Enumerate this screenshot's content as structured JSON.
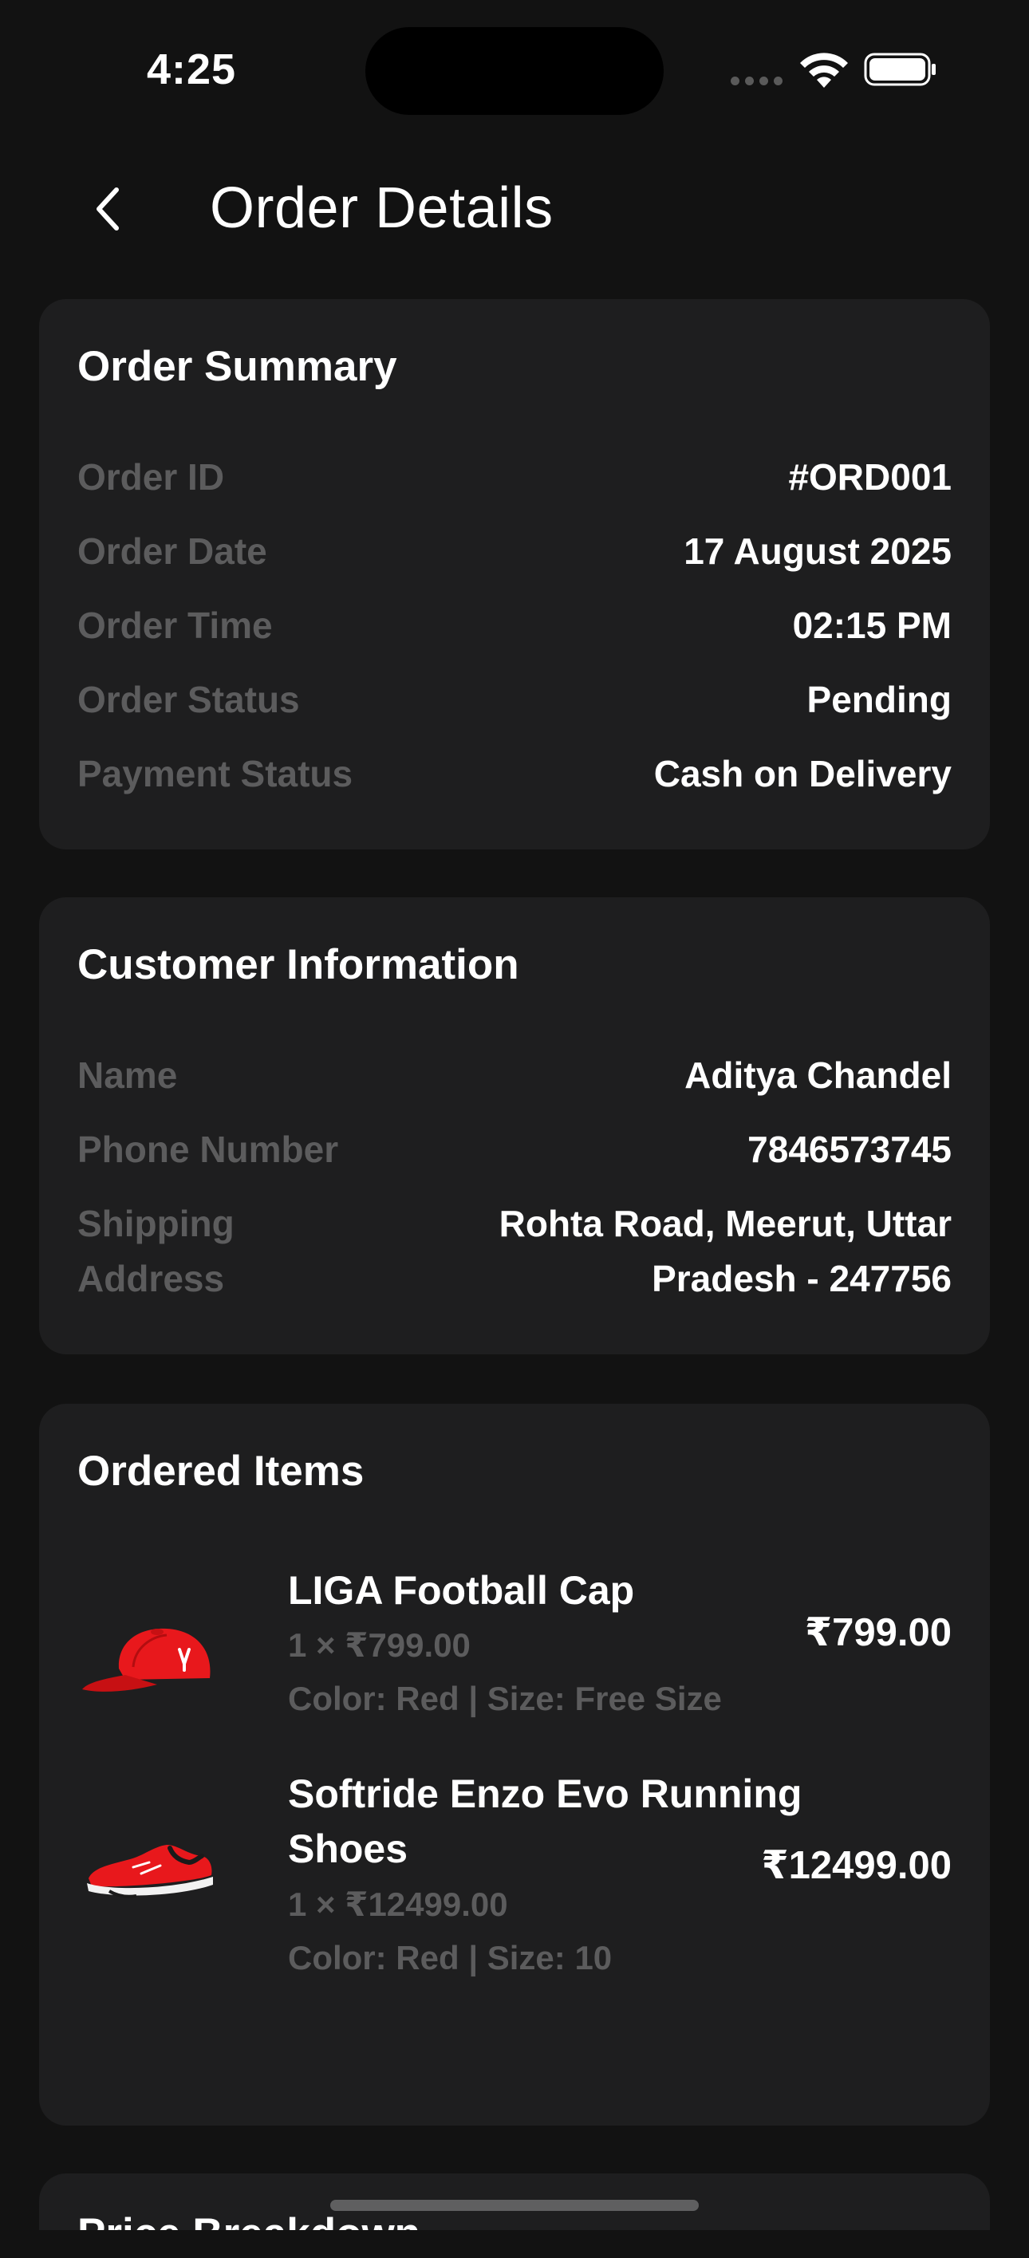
{
  "status_bar": {
    "time": "4:25"
  },
  "header": {
    "title": "Order Details"
  },
  "order_summary": {
    "title": "Order Summary",
    "rows": [
      {
        "label": "Order ID",
        "value": "#ORD001"
      },
      {
        "label": "Order Date",
        "value": "17 August 2025"
      },
      {
        "label": "Order Time",
        "value": "02:15 PM"
      },
      {
        "label": "Order Status",
        "value": "Pending"
      },
      {
        "label": "Payment Status",
        "value": "Cash on Delivery"
      }
    ]
  },
  "customer_info": {
    "title": "Customer Information",
    "rows": [
      {
        "label": "Name",
        "value": "Aditya Chandel"
      },
      {
        "label": "Phone Number",
        "value": "7846573745"
      },
      {
        "label_line1": "Shipping",
        "label_line2": "Address",
        "value_line1": "Rohta Road, Meerut, Uttar",
        "value_line2": "Pradesh - 247756"
      }
    ]
  },
  "ordered_items": {
    "title": "Ordered Items",
    "items": [
      {
        "name": "LIGA Football Cap",
        "quantity_price": "1 × ₹799.00",
        "variant": "Color: Red | Size: Free Size",
        "price": "₹799.00",
        "icon": "red-cap-icon"
      },
      {
        "name_line1": "Softride Enzo Evo Running",
        "name_line2": "Shoes",
        "quantity_price": "1 × ₹12499.00",
        "variant": "Color: Red | Size: 10",
        "price": "₹12499.00",
        "icon": "red-running-shoe-icon"
      }
    ]
  },
  "price_breakdown": {
    "title": "Price Breakdown"
  },
  "colors": {
    "background": "#121212",
    "card": "#1e1e1f",
    "label": "#5c5c5d",
    "text": "#ffffff",
    "product_red": "#e8181c"
  }
}
